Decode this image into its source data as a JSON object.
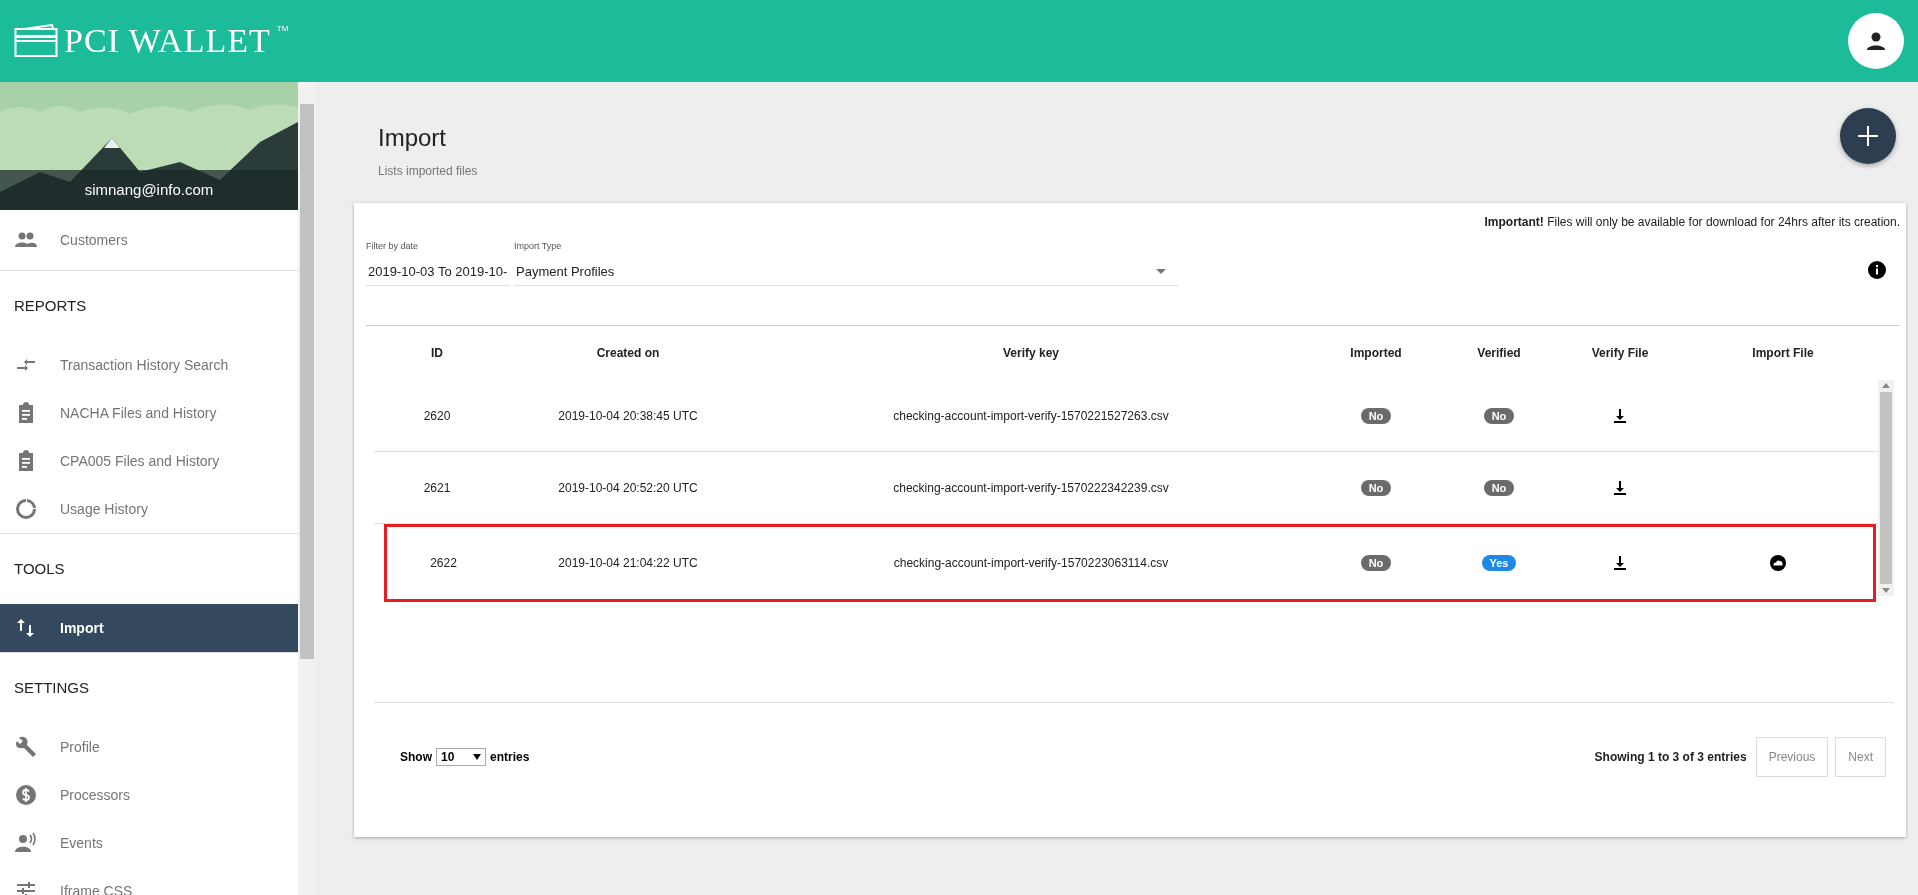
{
  "header": {
    "logo": "PCI WALLET",
    "trademark": "TM"
  },
  "sidebar": {
    "email": "simnang@info.com",
    "groups": [
      {
        "items": [
          {
            "label": "Customers",
            "kind": "people",
            "selected": false
          }
        ]
      },
      {
        "heading": "REPORTS",
        "items": [
          {
            "label": "Transaction History Search",
            "kind": "arrows",
            "selected": false
          },
          {
            "label": "NACHA Files and History",
            "kind": "clipboard",
            "selected": false
          },
          {
            "label": "CPA005 Files and History",
            "kind": "clipboard",
            "selected": false
          },
          {
            "label": "Usage History",
            "kind": "ring",
            "selected": false
          }
        ]
      },
      {
        "heading": "TOOLS",
        "items": [
          {
            "label": "Import",
            "kind": "updown",
            "selected": true
          }
        ]
      },
      {
        "heading": "SETTINGS",
        "items": [
          {
            "label": "Profile",
            "kind": "wrench",
            "selected": false
          },
          {
            "label": "Processors",
            "kind": "dollar",
            "selected": false
          },
          {
            "label": "Events",
            "kind": "speaker",
            "selected": false
          },
          {
            "label": "Iframe CSS",
            "kind": "sliders",
            "selected": false
          }
        ]
      }
    ]
  },
  "page": {
    "title": "Import",
    "subtitle": "Lists imported files"
  },
  "notice": "**Important!** Files will only be available for download for 24hrs after its creation.",
  "filters": {
    "date_label": "Filter by date",
    "date_value": "2019-10-03 To 2019-10-",
    "type_label": "Import Type",
    "type_value": "Payment Profiles"
  },
  "table": {
    "columns": [
      "ID",
      "Created on",
      "Verify key",
      "Imported",
      "Verified",
      "Verify File",
      "Import File"
    ],
    "rows": [
      {
        "id": "2620",
        "created": "2019-10-04 20:38:45 UTC",
        "key": "checking-account-import-verify-1570221527263.csv",
        "imported": {
          "text": "No",
          "on": false
        },
        "verified": {
          "text": "No",
          "on": false
        },
        "import_file": false,
        "highlighted": false
      },
      {
        "id": "2621",
        "created": "2019-10-04 20:52:20 UTC",
        "key": "checking-account-import-verify-1570222342239.csv",
        "imported": {
          "text": "No",
          "on": false
        },
        "verified": {
          "text": "No",
          "on": false
        },
        "import_file": false,
        "highlighted": false
      },
      {
        "id": "2622",
        "created": "2019-10-04 21:04:22 UTC",
        "key": "checking-account-import-verify-1570223063114.csv",
        "imported": {
          "text": "No",
          "on": false
        },
        "verified": {
          "text": "Yes",
          "on": true
        },
        "import_file": true,
        "highlighted": true
      }
    ]
  },
  "footer": {
    "show": "Show",
    "page_size": "10",
    "entries": "entries",
    "summary": "Showing 1 to 3 of 3 entries",
    "buttons": [
      {
        "label": "Previous",
        "disabled": true
      },
      {
        "label": "Next",
        "disabled": true
      }
    ]
  }
}
